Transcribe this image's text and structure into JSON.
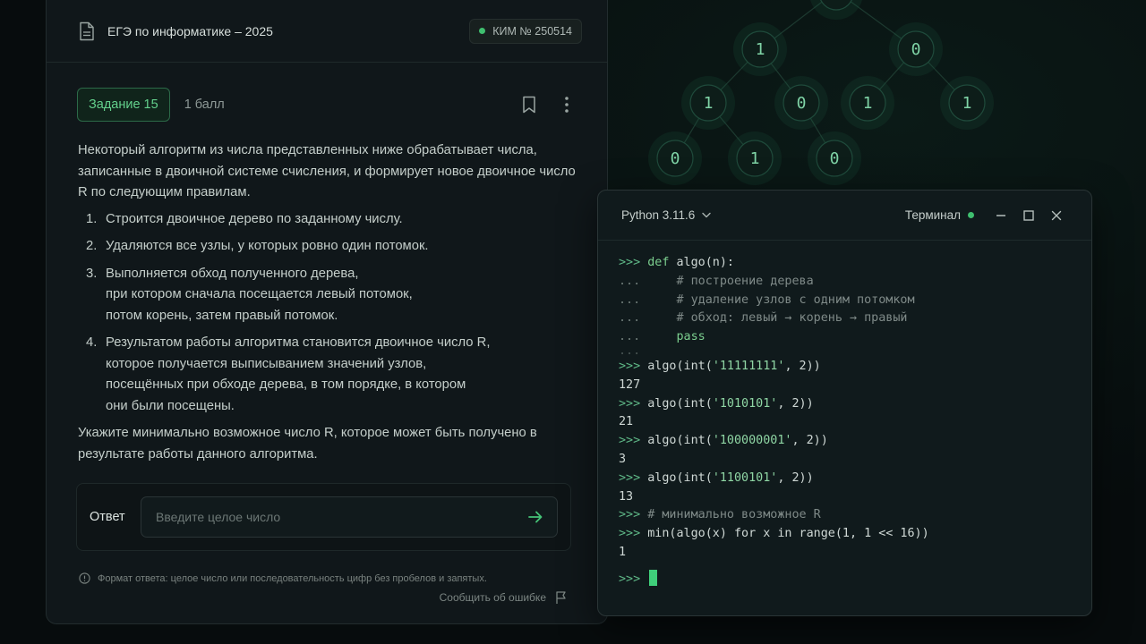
{
  "task": {
    "header_title": "ЕГЭ по информатике – 2025",
    "kim_label": "КИМ № 250514",
    "chip": "Задание 15",
    "points": "1 балл",
    "intro": "Некоторый алгоритм из числа представленных ниже обрабатывает числа, записанные в двоичной системе счисления, и формирует новое двоичное число R по следующим правилам.",
    "steps": [
      {
        "num": "1.",
        "text": "Строится двоичное дерево по заданному числу."
      },
      {
        "num": "2.",
        "text": "Удаляются все узлы, у которых ровно один потомок."
      },
      {
        "num": "3.",
        "text": "Выполняется обход полученного дерева,\nпри котором сначала посещается левый потомок,\nпотом корень, затем правый потомок."
      },
      {
        "num": "4.",
        "text": "Результатом работы алгоритма становится двоичное число R,\nкоторое получается выписыванием значений узлов,\nпосещённых при обходе дерева, в том порядке, в котором\nони были посещены."
      }
    ],
    "question": "Укажите минимально возможное число R, которое может быть получено в результате работы данного алгоритма.",
    "answer_label": "Ответ",
    "answer_placeholder": "Введите целое число",
    "format_hint": "Формат ответа: целое число или последовательность цифр без пробелов и запятых.",
    "report_label": "Сообщить об ошибке"
  },
  "terminal": {
    "python_version": "Python 3.11.6",
    "label": "Терминал",
    "lines": {
      "l1_prompt": ">>> ",
      "l1_kw": "def",
      "l1_rest": " algo(n):",
      "l2_prompt": "...     ",
      "l2_comment": "# построение дерева",
      "l3_prompt": "...     ",
      "l3_comment": "# удаление узлов с одним потомком",
      "l4_prompt": "...     ",
      "l4_comment": "# обход: левый → корень → правый",
      "l5_prompt": "...     ",
      "l5_kw": "pass",
      "l6_prompt": "...",
      "l7_prompt": ">>> ",
      "l7_a": "algo(int(",
      "l7_str": "'11111111'",
      "l7_b": ", 2))",
      "l8_out": "127",
      "l9_prompt": ">>> ",
      "l9_a": "algo(int(",
      "l9_str": "'1010101'",
      "l9_b": ", 2))",
      "l10_out": "21",
      "l11_prompt": ">>> ",
      "l11_a": "algo(int(",
      "l11_str": "'100000001'",
      "l11_b": ", 2))",
      "l12_out": "3",
      "l13_prompt": ">>> ",
      "l13_a": "algo(int(",
      "l13_str": "'1100101'",
      "l13_b": ", 2))",
      "l14_out": "13",
      "l15_prompt": ">>> ",
      "l15_comment": "# минимально возможное R",
      "l16_prompt": ">>> ",
      "l16_code": "min(algo(x) for x in range(1, 1 << 16))",
      "l17_out": "1",
      "l18_prompt": ">>> "
    }
  },
  "tree": {
    "nodes": [
      "1",
      "0",
      "1",
      "0",
      "1",
      "1",
      "0",
      "1",
      "0"
    ]
  },
  "colors": {
    "accent_green": "#3fbf6f",
    "background": "#070c0d",
    "card": "#10171a",
    "terminal": "#101a1c"
  }
}
